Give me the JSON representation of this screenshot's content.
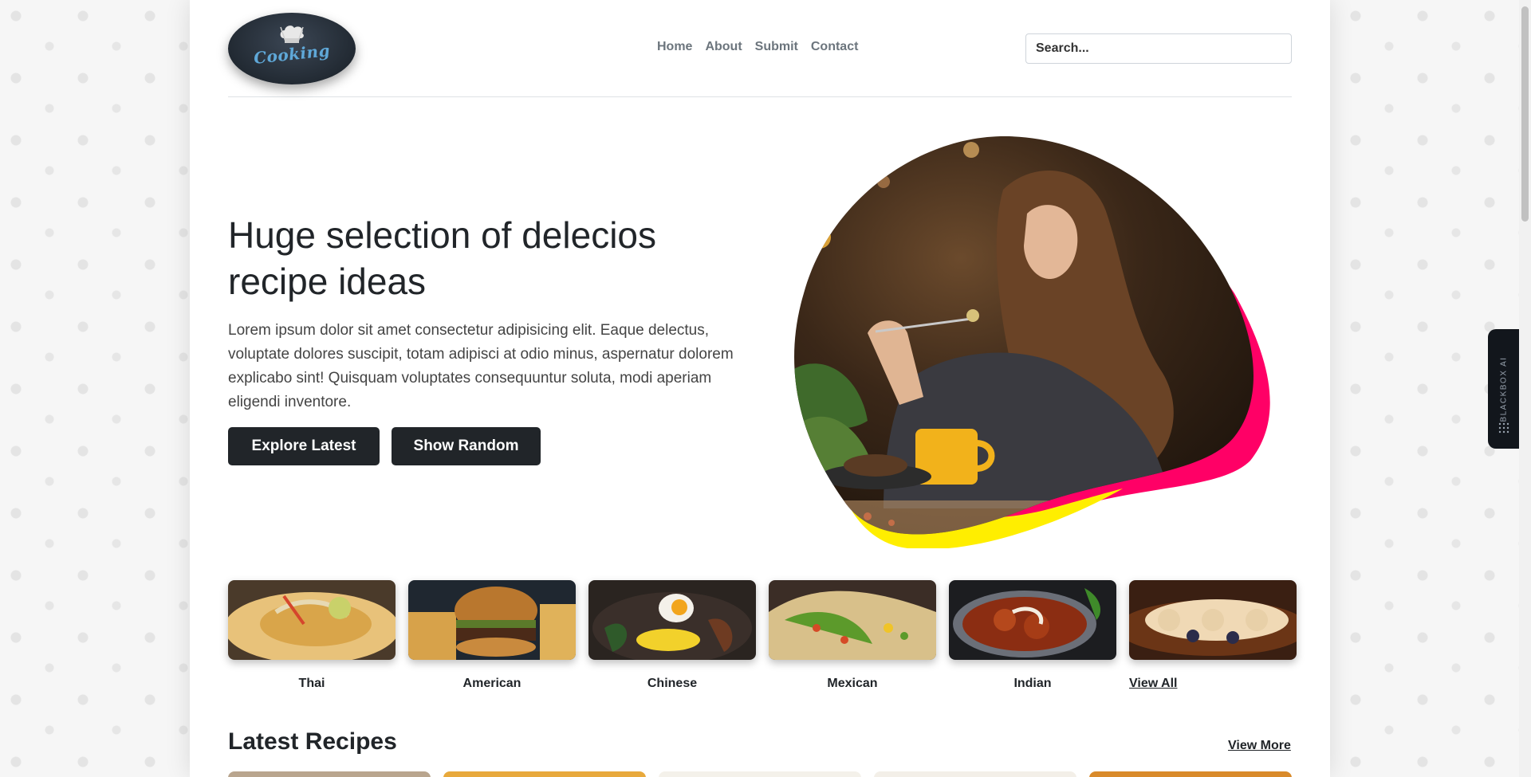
{
  "header": {
    "logo_text": "Cooking",
    "nav": [
      {
        "label": "Home"
      },
      {
        "label": "About"
      },
      {
        "label": "Submit"
      },
      {
        "label": "Contact"
      }
    ],
    "search": {
      "placeholder": "Search..."
    }
  },
  "hero": {
    "title": "Huge selection of delecios recipe ideas",
    "text": "Lorem ipsum dolor sit amet consectetur adipisicing elit. Eaque delectus, voluptate dolores suscipit, totam adipisci at odio minus, aspernatur dolorem explicabo sint! Quisquam voluptates consequuntur soluta, modi aperiam eligendi inventore.",
    "explore_label": "Explore Latest",
    "random_label": "Show Random"
  },
  "categories": [
    {
      "label": "Thai"
    },
    {
      "label": "American"
    },
    {
      "label": "Chinese"
    },
    {
      "label": "Mexican"
    },
    {
      "label": "Indian"
    },
    {
      "label": "View All"
    }
  ],
  "latest": {
    "title": "Latest Recipes",
    "view_more": "View More"
  },
  "side_tab": {
    "label": "BLACKBOX AI"
  },
  "colors": {
    "dark": "#212529",
    "blob_pink": "#ff0066",
    "blob_yellow": "#ffee00"
  }
}
